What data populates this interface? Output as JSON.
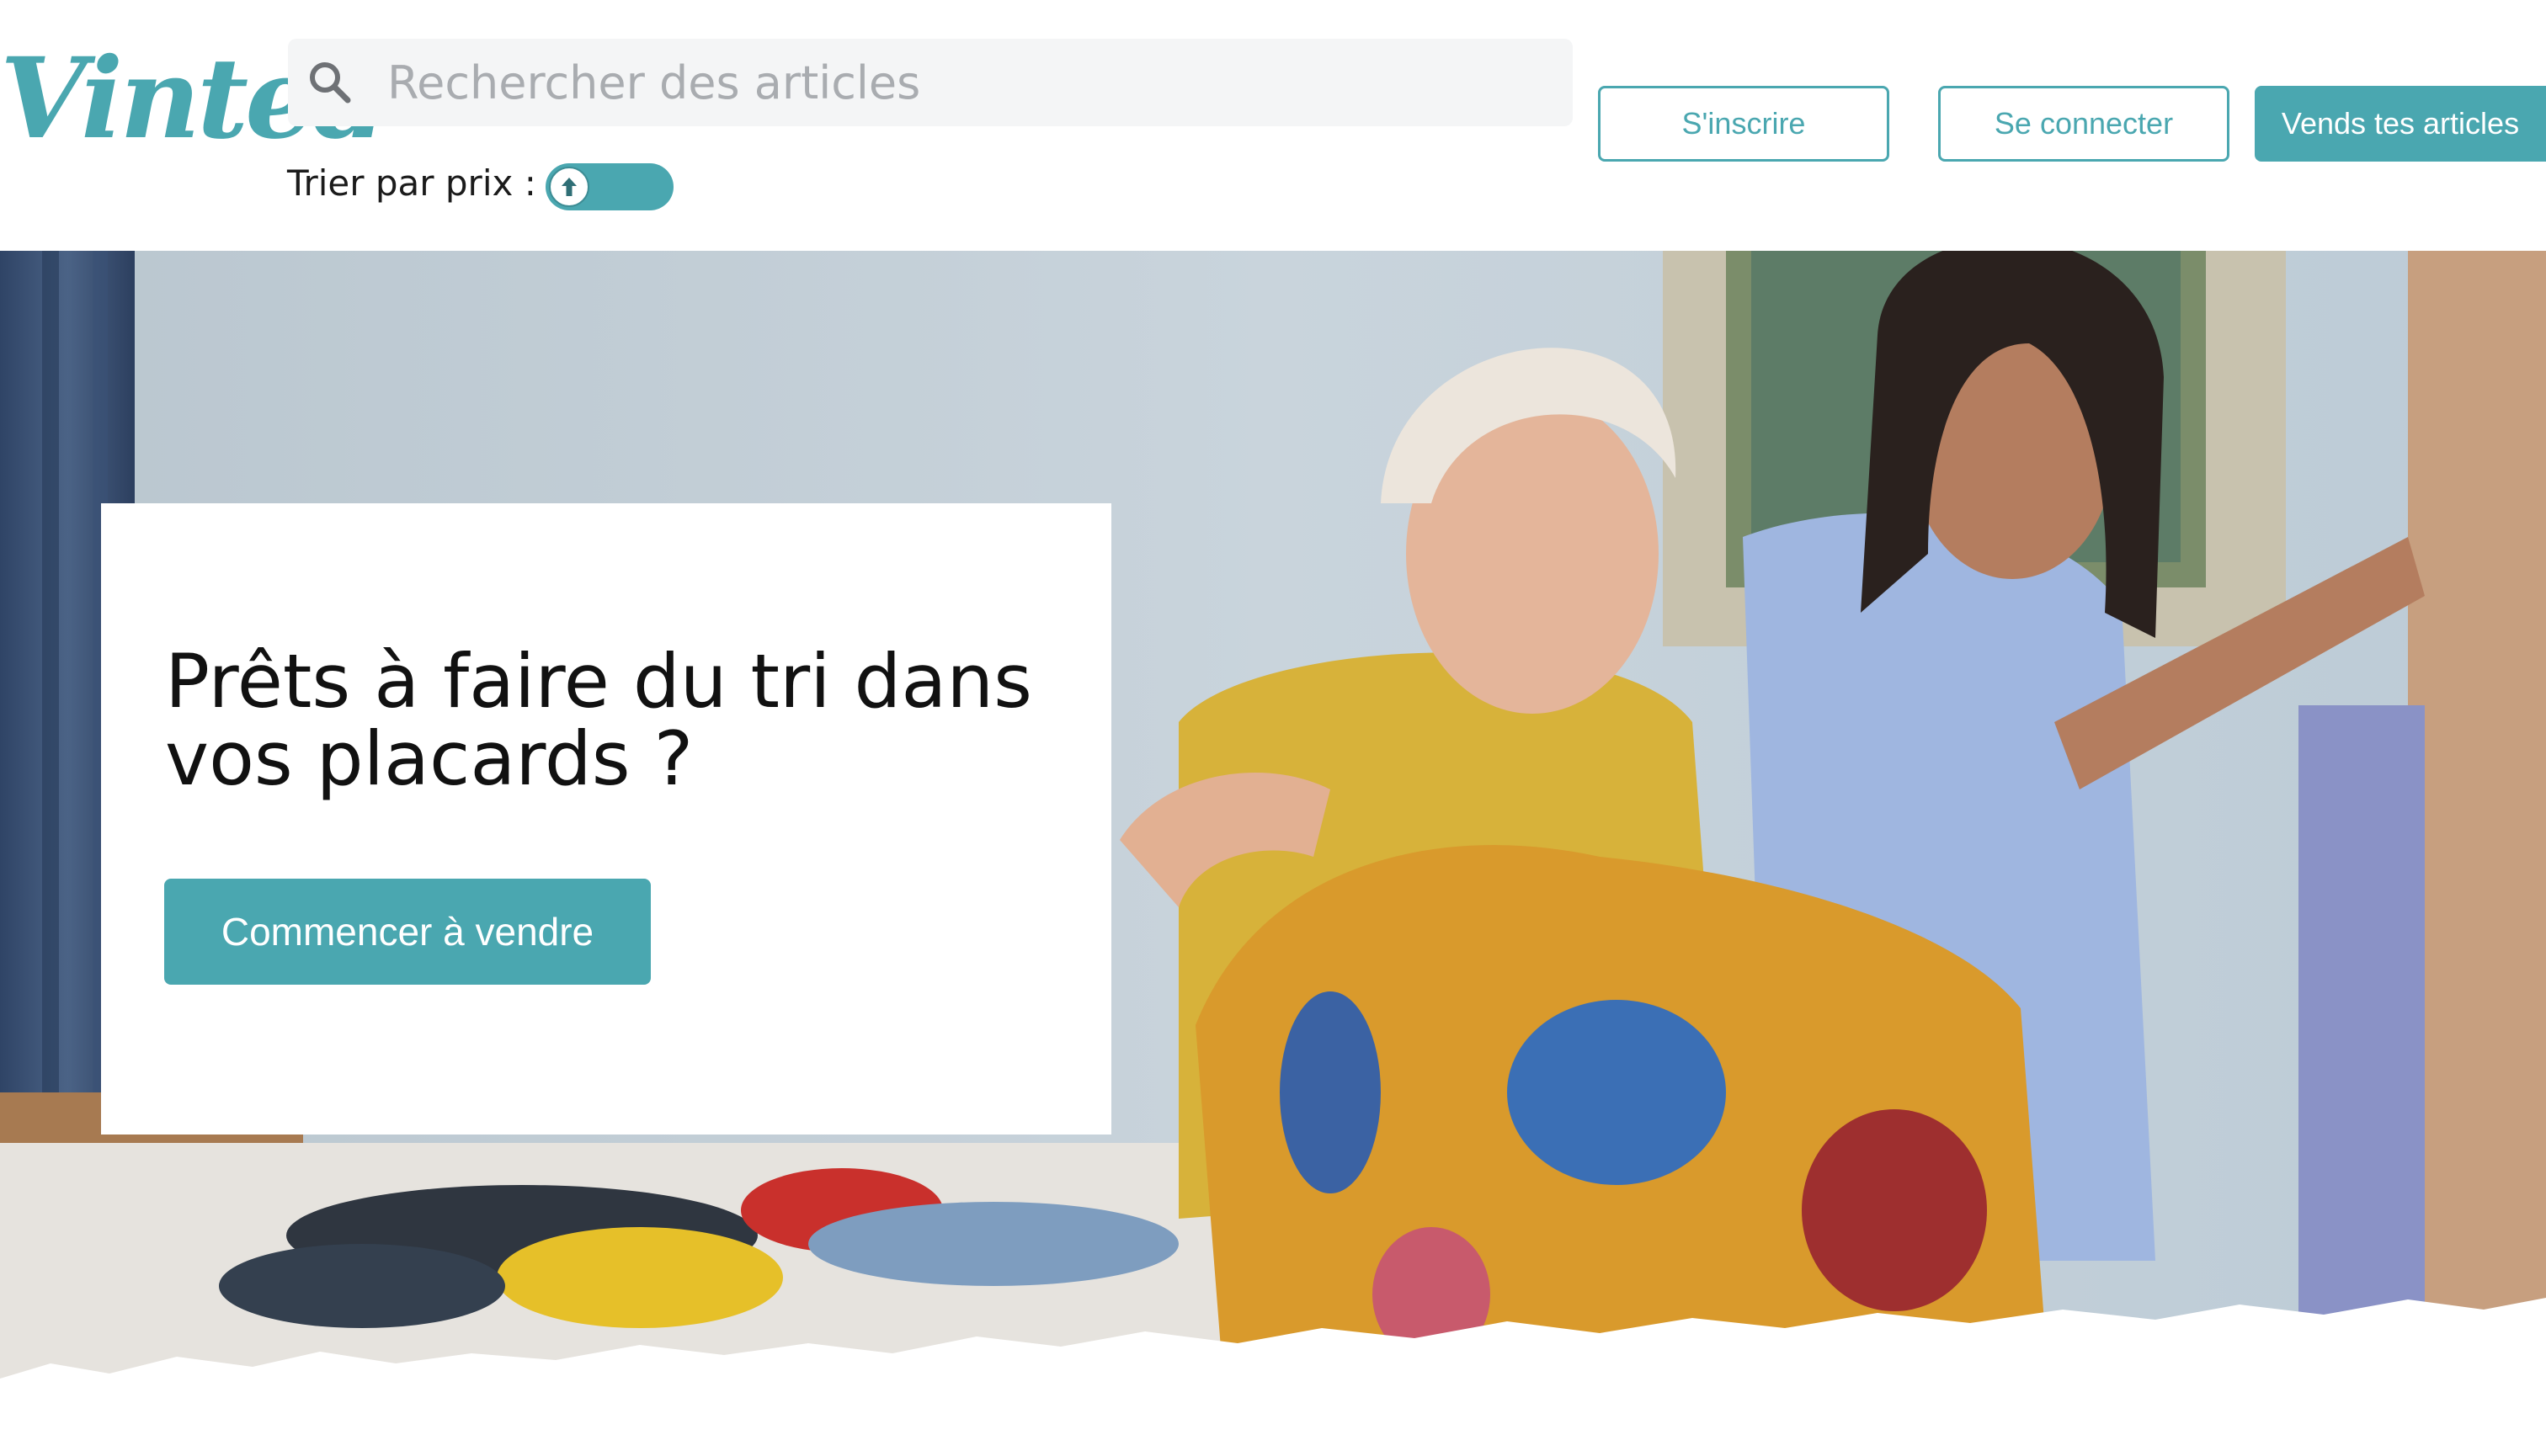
{
  "brand": {
    "logo_text": "Vinted",
    "accent_color": "#4aa7b0"
  },
  "search": {
    "placeholder": "Rechercher des articles",
    "value": "",
    "icon": "search-icon"
  },
  "sort": {
    "label": "Trier par prix :",
    "direction_icon": "arrow-up-icon"
  },
  "nav": {
    "signup_label": "S'inscrire",
    "login_label": "Se connecter",
    "sell_label": "Vends tes articles"
  },
  "hero": {
    "title": "Prêts à faire du tri dans vos placards ?",
    "cta_label": "Commencer à vendre"
  }
}
